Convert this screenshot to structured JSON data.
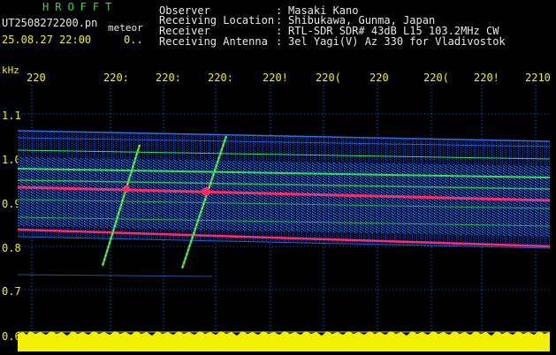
{
  "header": {
    "app_title": "HROFFT",
    "file_name": "UT2508272200.pn",
    "meteor_tag": "meteor",
    "date_time": "25.08.27 22:00",
    "counter": "0..",
    "info": [
      {
        "key": "Observer",
        "value": "Masaki Kano"
      },
      {
        "key": "Receiving Location",
        "value": "Shibukawa, Gunma, Japan"
      },
      {
        "key": "Receiver",
        "value": "RTL-SDR SDR# 43dB L15 103.2MHz CW"
      },
      {
        "key": "Receiving Antenna",
        "value": "3el Yagi(V) Az 330 for Vladivostok"
      }
    ]
  },
  "axes": {
    "unit": "kHz",
    "time_ticks": [
      "220",
      "220:",
      "220:",
      "220:",
      "220!",
      "220(",
      "220",
      "220(",
      "220!",
      "2210"
    ],
    "freq_ticks": [
      "1.1",
      "1.0",
      "0.9",
      "0.8",
      "0.7",
      "0.6"
    ]
  },
  "colors": {
    "background": "#000000",
    "label": "#f2f200",
    "title": "#39d639",
    "noise_floor": "#f2f200",
    "strong_signal": "#ff2a6a",
    "medium_signal": "#2ee05a",
    "weak_signal": "#2a7bd8",
    "grid": "#2a8cff"
  }
}
